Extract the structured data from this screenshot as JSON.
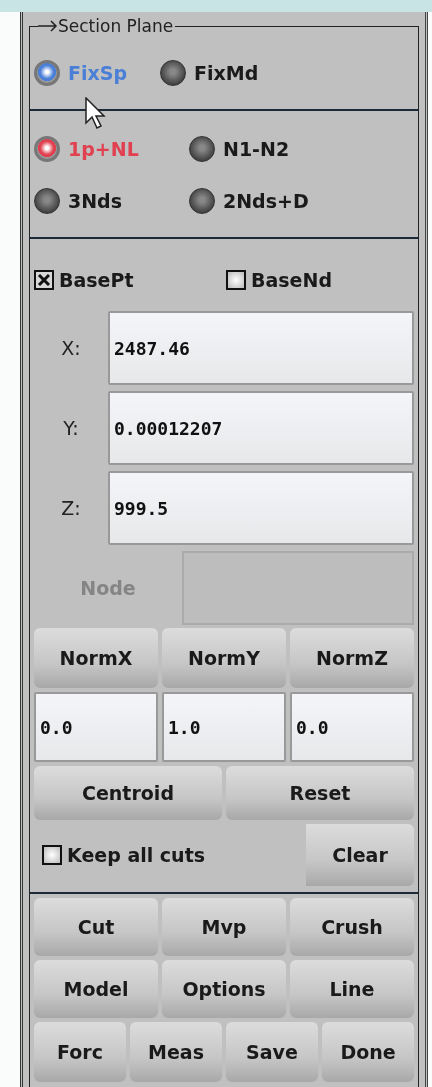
{
  "section": {
    "title": "Section Plane"
  },
  "radio_groups": [
    {
      "color": "#4a7fd8",
      "options": [
        {
          "label": "FixSp",
          "selected": true
        },
        {
          "label": "FixMd",
          "selected": false
        }
      ]
    },
    {
      "color": "#e04050",
      "options": [
        {
          "label": "1p+NL",
          "selected": true
        },
        {
          "label": "N1-N2",
          "selected": false
        },
        {
          "label": "3Nds",
          "selected": false
        },
        {
          "label": "2Nds+D",
          "selected": false
        }
      ]
    }
  ],
  "base_options": [
    {
      "label": "BasePt",
      "checked": true
    },
    {
      "label": "BaseNd",
      "checked": false
    }
  ],
  "coordinates": [
    {
      "label": "X:",
      "value": "2487.46"
    },
    {
      "label": "Y:",
      "value": "0.00012207"
    },
    {
      "label": "Z:",
      "value": "999.5"
    }
  ],
  "node": {
    "label": "Node",
    "disabled": true
  },
  "normal_buttons": [
    "NormX",
    "NormY",
    "NormZ"
  ],
  "normal_values": [
    "0.0",
    "1.0",
    "0.0"
  ],
  "point_buttons": [
    "Centroid",
    "Reset"
  ],
  "keep_all_cuts": {
    "label": "Keep all cuts",
    "checked": false
  },
  "clear_button": "Clear",
  "action_rows": [
    [
      "Cut",
      "Mvp",
      "Crush"
    ],
    [
      "Model",
      "Options",
      "Line"
    ],
    [
      "Forc",
      "Meas",
      "Save",
      "Done"
    ]
  ]
}
